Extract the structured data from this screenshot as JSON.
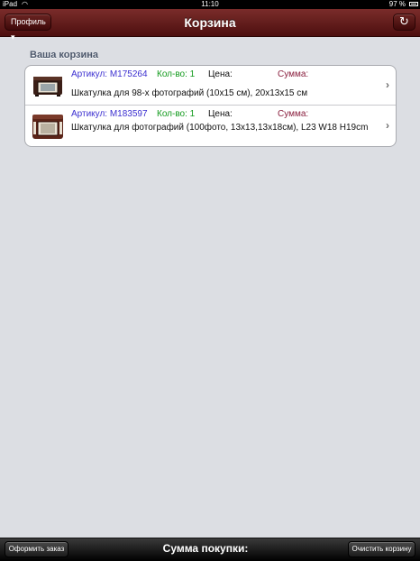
{
  "status_bar": {
    "device": "iPad",
    "time": "11:10",
    "battery": "97 %"
  },
  "nav": {
    "title": "Корзина",
    "profile_label": "Профиль ▾",
    "refresh_glyph": "↻"
  },
  "cart": {
    "section_title": "Ваша корзина",
    "items": [
      {
        "article": "Артикул: M175264",
        "qty": "Кол-во: 1",
        "price": "Цена:",
        "sum": "Сумма:",
        "description": "Шкатулка для 98-х фотографий (10x15 см), 20х13х15 см"
      },
      {
        "article": "Артикул: M183597",
        "qty": "Кол-во: 1",
        "price": "Цена:",
        "sum": "Сумма:",
        "description": "Шкатулка для фотографий (100фото, 13х13,13х18см), L23 W18 H19cm"
      }
    ]
  },
  "toolbar": {
    "order_label": "Оформить заказ",
    "total_label": "Сумма покупки:",
    "clear_label": "Очистить корзину"
  },
  "colors": {
    "nav_top": "#7a2c2a",
    "nav_bottom": "#4d0f0f",
    "article": "#3b2fd0",
    "qty": "#129a1c",
    "sum": "#8a1f3e",
    "background": "#dcdee3"
  }
}
